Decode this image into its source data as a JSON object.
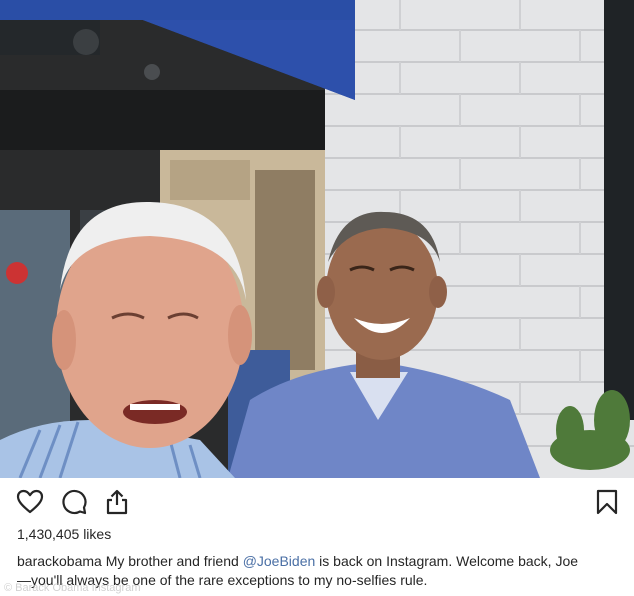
{
  "post": {
    "like_count": "1,430,405",
    "likes_suffix": "likes",
    "username": "barackobama",
    "caption_before_mention": "My brother and friend",
    "mention": "@JoeBiden",
    "caption_after_mention": "is back on Instagram. Welcome back, Joe",
    "caption_line2": "—you'll always be one of the rare exceptions to my no-selfies rule."
  },
  "icons": {
    "like": "heart-icon",
    "comment": "comment-icon",
    "share": "share-icon",
    "save": "bookmark-icon"
  },
  "watermark": "© Barack Obama Instagram",
  "colors": {
    "awning": "#2b4ea8",
    "brick": "#e6e7e9",
    "shirt_blue": "#6f86c7"
  }
}
